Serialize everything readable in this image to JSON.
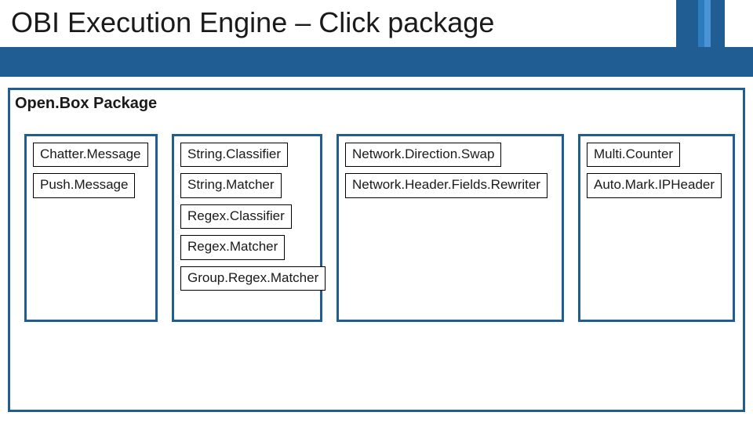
{
  "title": "OBI Execution Engine – Click package",
  "package_label": "Open.Box Package",
  "columns": [
    {
      "items": [
        "Chatter.Message",
        "Push.Message"
      ]
    },
    {
      "items": [
        "String.Classifier",
        "String.Matcher",
        "Regex.Classifier",
        "Regex.Matcher",
        "Group.Regex.Matcher"
      ]
    },
    {
      "items": [
        "Network.Direction.Swap",
        "Network.Header.Fields.Rewriter"
      ]
    },
    {
      "items": [
        "Multi.Counter",
        "Auto.Mark.IPHeader"
      ]
    }
  ]
}
